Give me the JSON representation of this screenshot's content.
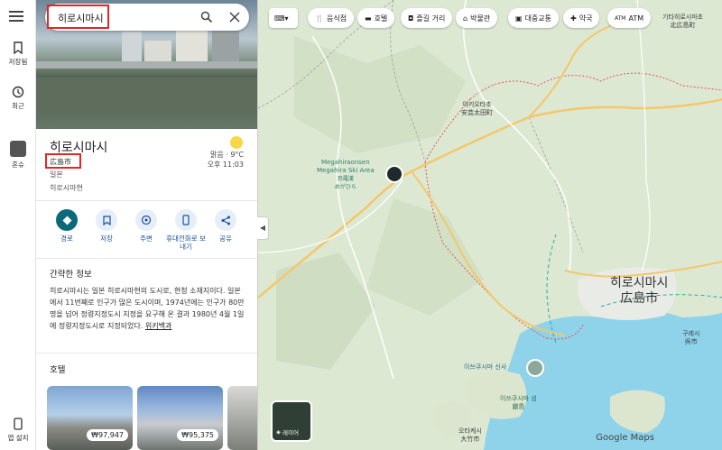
{
  "rail": {
    "saved_label": "저장됨",
    "recent_label": "최근",
    "user_label": "혼슈",
    "app_install_label": "앱 설치"
  },
  "search": {
    "value": "히로시마시"
  },
  "place": {
    "name": "히로시마시",
    "name_native": "広島市",
    "country": "일본",
    "region": "히로시마현",
    "weather_line1": "맑음 · 9°C",
    "weather_line2": "오후 11:03"
  },
  "actions": [
    {
      "label": "경로",
      "icon": "directions-icon"
    },
    {
      "label": "저장",
      "icon": "bookmark-icon"
    },
    {
      "label": "주변",
      "icon": "nearby-icon"
    },
    {
      "label": "휴대전화로 보내기",
      "icon": "phone-icon"
    },
    {
      "label": "공유",
      "icon": "share-icon"
    }
  ],
  "summary": {
    "title": "간략한 정보",
    "text": "히로시마시는 일본 히로시마현의 도시로, 현청 소재지이다. 일본에서 11번째로 인구가 많은 도시이며, 1974년에는 인구가 80만 명을 넘어 정령지정도시 지정을 요구해 온 결과 1980년 4월 1일에 정령지정도시로 지정되었다.",
    "link": "위키백과"
  },
  "hotels": {
    "title": "호텔",
    "items": [
      {
        "price": "₩97,947"
      },
      {
        "price": "₩95,375"
      }
    ]
  },
  "map": {
    "chips": [
      "음식점",
      "호텔",
      "즐길 거리",
      "박물관",
      "대중교통",
      "약국",
      "ATM"
    ],
    "city_label_ko": "히로시마시",
    "city_label_ja": "広島市",
    "ski_label_en1": "Megahiraonsen",
    "ski_label_en2": "Megahira Ski Area",
    "ski_label_ja1": "恐羅漢",
    "ski_label_ja2": "めがひら",
    "akiota_ko": "아키오타초",
    "akiota_ja": "安芸太田町",
    "kitahiroshima_ko": "기타히로시마초",
    "kitahiroshima_ja": "北広島町",
    "itsukushima_ko": "이쓰쿠시마 신사",
    "itsukushima_island_ko": "이쓰쿠시마 섬",
    "itsukushima_island_ja": "厳島",
    "kure_ko": "구레시",
    "kure_ja": "呉市",
    "otake_ko": "오타케시",
    "otake_ja": "大竹市",
    "layers_label": "레이어",
    "attribution": "Google Maps",
    "colors": {
      "land": "#dfe9d6",
      "water": "#8ed3ea",
      "boundary": "#e1544a",
      "highway": "#f4c76a"
    }
  }
}
